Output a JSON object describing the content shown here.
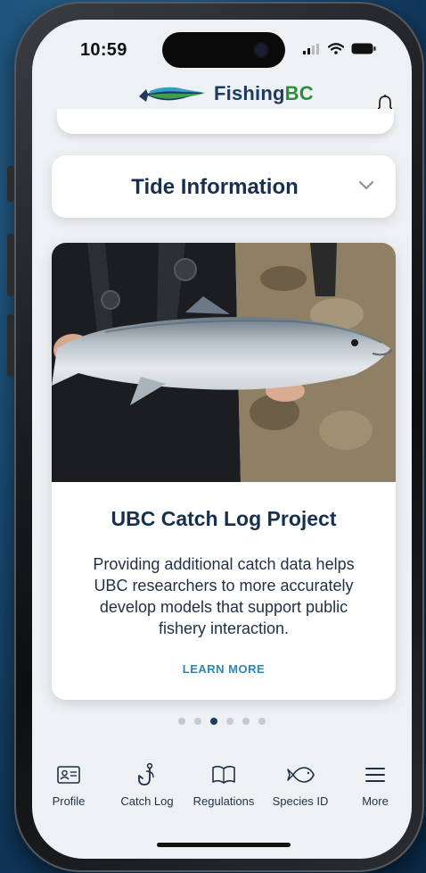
{
  "status": {
    "time": "10:59"
  },
  "app": {
    "brand_main": "Fishing",
    "brand_accent": "BC",
    "brand_color": "#1f3a60",
    "accent_color": "#2e8c3f"
  },
  "tide": {
    "title": "Tide Information",
    "icon": "chevron-down-icon"
  },
  "promo": {
    "title": "UBC Catch Log Project",
    "description": "Providing additional catch data helps UBC researchers to more accurately develop models that support public fishery interaction.",
    "cta": "LEARN MORE",
    "cta_color": "#2a88b4"
  },
  "carousel": {
    "count": 6,
    "active_index": 2
  },
  "tabs": [
    {
      "label": "Profile",
      "icon": "id-card-icon"
    },
    {
      "label": "Catch Log",
      "icon": "fish-hook-icon"
    },
    {
      "label": "Regulations",
      "icon": "book-icon"
    },
    {
      "label": "Species ID",
      "icon": "fish-outline-icon"
    },
    {
      "label": "More",
      "icon": "menu-icon"
    }
  ]
}
